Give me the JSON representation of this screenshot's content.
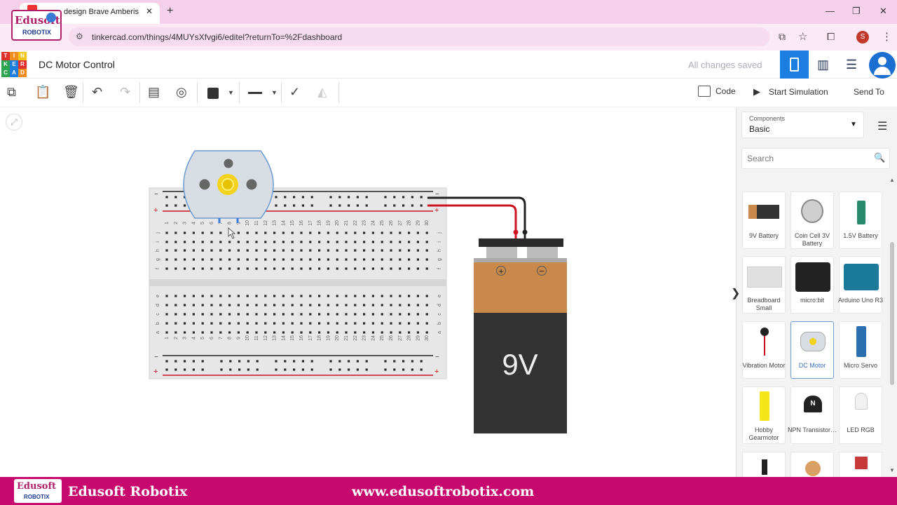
{
  "browser": {
    "tab_title": "design Brave Amberis - T",
    "tab_close": "✕",
    "new_tab": "+",
    "url": "tinkercad.com/things/4MUYsXfvgi6/editel?returnTo=%2Fdashboard",
    "profile_initial": "S",
    "window_controls": [
      "—",
      "❐",
      "✕"
    ]
  },
  "logo": {
    "brand_top": "Edusoft",
    "brand_bottom": "ROBOTIX"
  },
  "app": {
    "logo_letters": [
      "T",
      "I",
      "N",
      "K",
      "E",
      "R",
      "C",
      "A",
      "D"
    ],
    "project_title": "DC Motor Control",
    "save_status": "All changes saved"
  },
  "toolbar": {
    "code_label": "Code",
    "start_simulation_label": "Start Simulation",
    "send_to_label": "Send To"
  },
  "breadboard": {
    "column_numbers": [
      "1",
      "2",
      "3",
      "4",
      "5",
      "6",
      "7",
      "8",
      "9",
      "10",
      "11",
      "12",
      "13",
      "14",
      "15",
      "16",
      "17",
      "18",
      "19",
      "20",
      "21",
      "22",
      "23",
      "24",
      "25",
      "26",
      "27",
      "28",
      "29",
      "30"
    ],
    "row_letters_top": [
      "j",
      "i",
      "h",
      "g",
      "f"
    ],
    "row_letters_bottom": [
      "e",
      "d",
      "c",
      "b",
      "a"
    ],
    "rail_minus": "−",
    "rail_plus": "+"
  },
  "battery": {
    "label": "9V",
    "plus": "+",
    "minus": "−"
  },
  "panel": {
    "components_label": "Components",
    "components_value": "Basic",
    "search_placeholder": "Search",
    "items": [
      {
        "label": "9V Battery",
        "icon": "battery-9v-icon"
      },
      {
        "label": "Coin Cell 3V Battery",
        "icon": "coin-cell-icon"
      },
      {
        "label": "1.5V Battery",
        "icon": "battery-aa-icon"
      },
      {
        "label": "Breadboard Small",
        "icon": "breadboard-icon"
      },
      {
        "label": "micro:bit",
        "icon": "microbit-icon"
      },
      {
        "label": "Arduino Uno R3",
        "icon": "arduino-icon"
      },
      {
        "label": "Vibration Motor",
        "icon": "vibration-motor-icon"
      },
      {
        "label": "DC Motor",
        "icon": "dc-motor-icon",
        "selected": true
      },
      {
        "label": "Micro Servo",
        "icon": "micro-servo-icon"
      },
      {
        "label": "Hobby Gearmotor",
        "icon": "gearmotor-icon"
      },
      {
        "label": "NPN Transistor…",
        "icon": "npn-transistor-icon"
      },
      {
        "label": "LED RGB",
        "icon": "led-rgb-icon"
      }
    ]
  },
  "footer": {
    "name": "Edusoft Robotix",
    "url": "www.edusoftrobotix.com"
  },
  "colors": {
    "tabbar": "#f5d0ea",
    "accent_blue": "#1b7ee0",
    "footer": "#c7086e",
    "wire_red": "#cc1122",
    "wire_black": "#222222",
    "battery_orange": "#c8894a",
    "battery_body": "#333333",
    "motor_yellow": "#f2d21a"
  }
}
